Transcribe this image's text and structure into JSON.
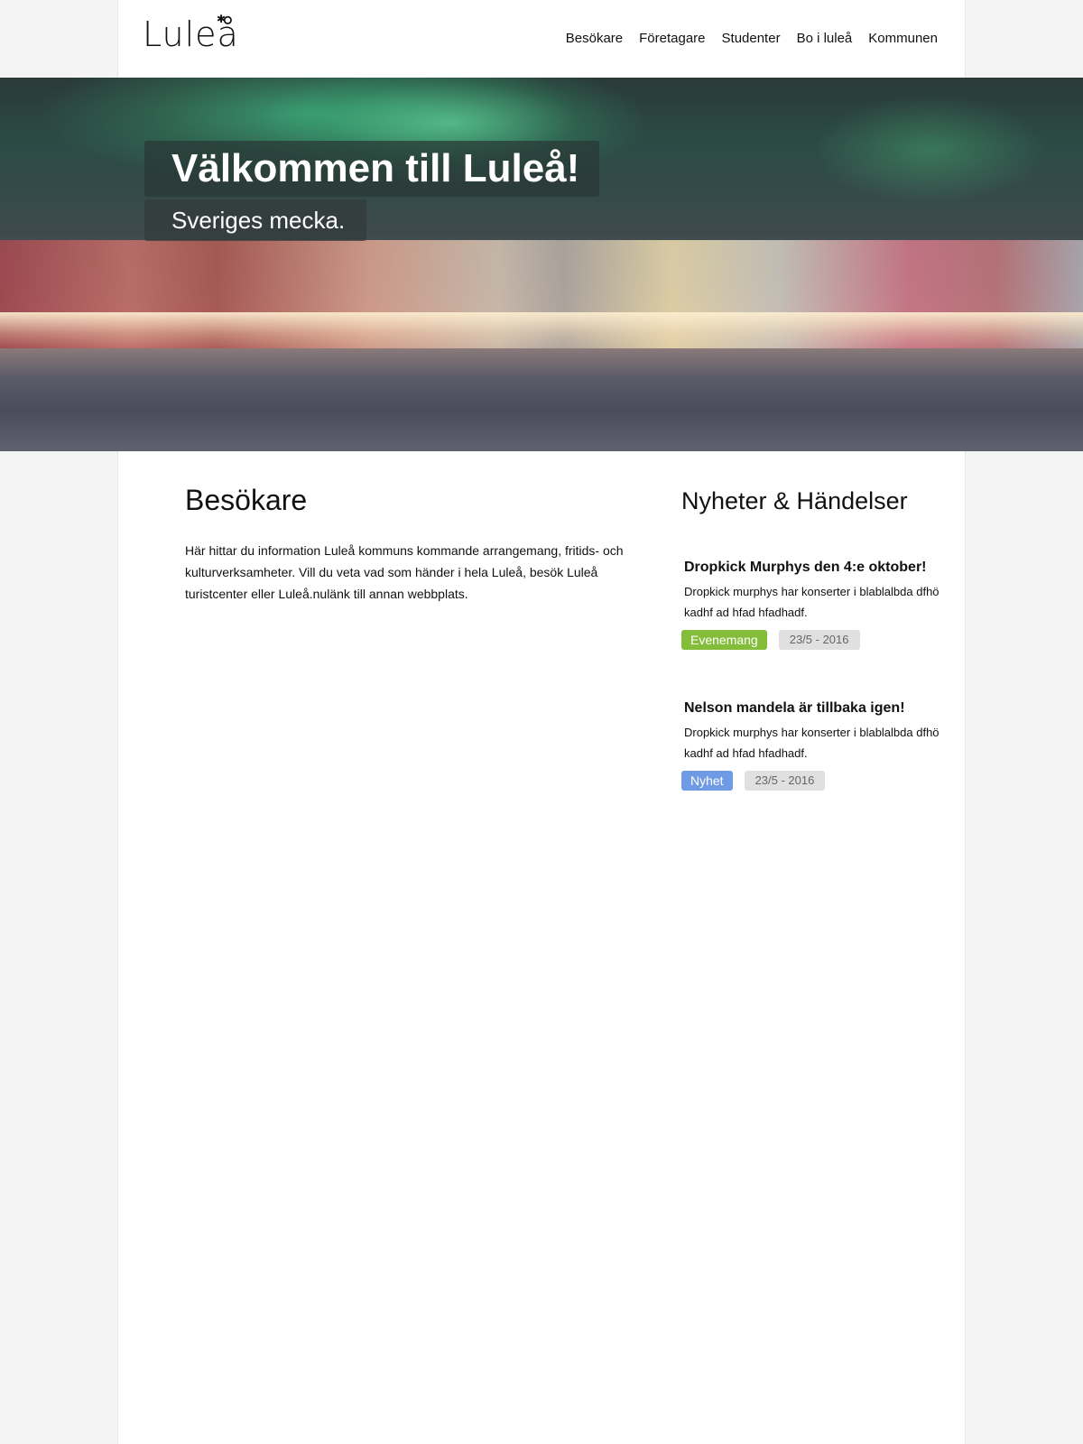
{
  "header": {
    "logo": "Luleå",
    "nav": [
      "Besökare",
      "Företagare",
      "Studenter",
      "Bo i luleå",
      "Kommunen"
    ]
  },
  "hero": {
    "title": "Välkommen till Luleå!",
    "subtitle": "Sveriges mecka."
  },
  "main": {
    "heading": "Besökare",
    "text": "Här hittar du information Luleå kommuns kommande arrangemang, fritids- och kulturverksamheter. Vill du veta vad som händer i hela Luleå, besök Luleå turistcenter eller Luleå.nulänk till annan webbplats."
  },
  "news": {
    "heading": "Nyheter & Händelser",
    "items": [
      {
        "title": "Dropkick Murphys den 4:e oktober!",
        "body": "Dropkick murphys har konserter i blablalbda dfhö kadhf ad hfad hfadhadf.",
        "tag": "Evenemang",
        "tag_color": "#84bd3a",
        "date": "23/5 - 2016"
      },
      {
        "title": "Nelson mandela är tillbaka igen!",
        "body": "Dropkick murphys har konserter i blablalbda dfhö kadhf ad hfad hfadhadf.",
        "tag": "Nyhet",
        "tag_color": "#6f9be5",
        "date": "23/5 - 2016"
      }
    ]
  }
}
